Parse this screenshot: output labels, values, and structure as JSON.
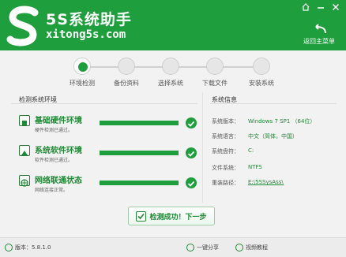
{
  "colors": {
    "brand_green": "#1e9e3c",
    "text_green": "#1e8a34",
    "background": "#f2f2f2"
  },
  "header": {
    "brand": "5S系统助手",
    "url": "xitong5s.com",
    "back_home_label": "返回主菜单",
    "window_controls": [
      "home-icon",
      "minimize-icon",
      "close-icon"
    ]
  },
  "steps": [
    {
      "label": "环境检测",
      "active": true
    },
    {
      "label": "备份资料",
      "active": false
    },
    {
      "label": "选择系统",
      "active": false
    },
    {
      "label": "下载文件",
      "active": false
    },
    {
      "label": "安装系统",
      "active": false
    }
  ],
  "left_panel": {
    "title": "检测系统环境",
    "checks": [
      {
        "title": "基础硬件环境",
        "subtitle": "硬件检测已通过。",
        "progress": 1.0,
        "icon": "hardware-icon"
      },
      {
        "title": "系统软件环境",
        "subtitle": "软件检测已通过。",
        "progress": 1.0,
        "icon": "software-icon"
      },
      {
        "title": "网络联通状态",
        "subtitle": "网络连接正常。",
        "progress": 1.0,
        "icon": "network-icon"
      }
    ]
  },
  "right_panel": {
    "title": "系统信息",
    "rows": [
      {
        "key": "系统版本：",
        "value": "Windows 7 SP1 （64位）"
      },
      {
        "key": "系统语言：",
        "value": "中文（简体，中国）"
      },
      {
        "key": "系统盘符：",
        "value": "C:"
      },
      {
        "key": "文件系统：",
        "value": "NTFS"
      },
      {
        "key": "重装路径：",
        "value": "E:\\5SSysAss\\"
      }
    ]
  },
  "next_button": {
    "label": "检测成功！下一步"
  },
  "footer": {
    "version": "版本：5.8.1.0",
    "share": "一键分享",
    "video": "视频教程"
  }
}
